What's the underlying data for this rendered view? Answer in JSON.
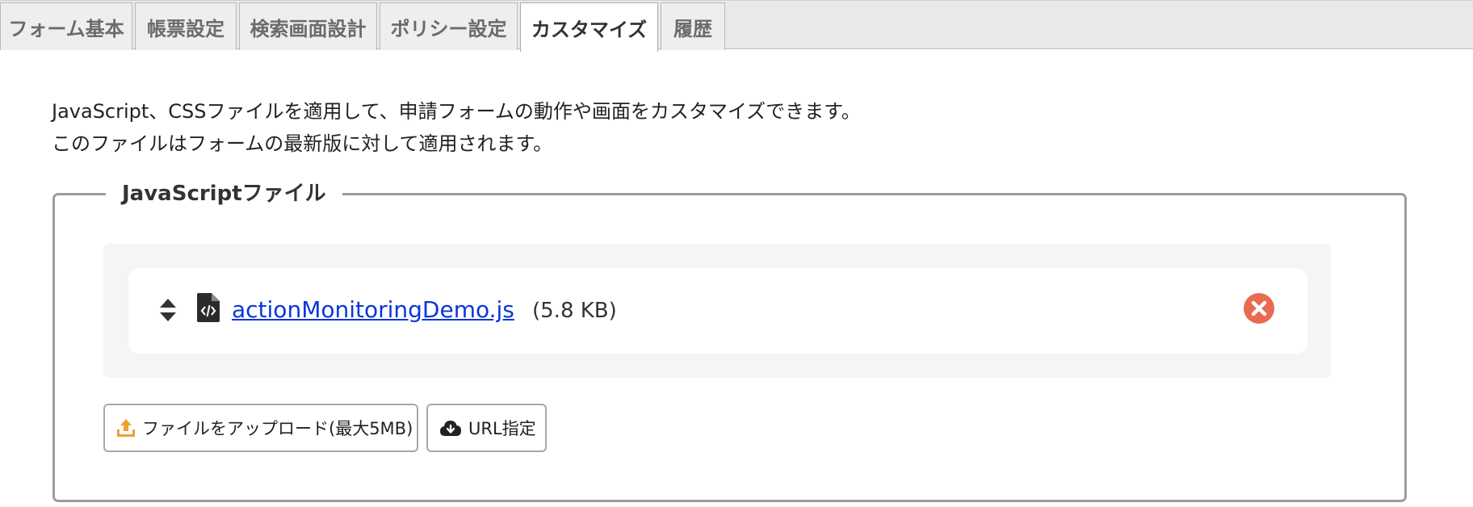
{
  "tabs": [
    {
      "label": "フォーム基本",
      "active": false
    },
    {
      "label": "帳票設定",
      "active": false
    },
    {
      "label": "検索画面設計",
      "active": false
    },
    {
      "label": "ポリシー設定",
      "active": false
    },
    {
      "label": "カスタマイズ",
      "active": true
    },
    {
      "label": "履歴",
      "active": false
    }
  ],
  "description": {
    "line1": "JavaScript、CSSファイルを適用して、申請フォームの動作や画面をカスタマイズできます。",
    "line2": "このファイルはフォームの最新版に対して適用されます。"
  },
  "javascript_section": {
    "legend": "JavaScriptファイル",
    "files": [
      {
        "name": "actionMonitoringDemo.js",
        "size": "(5.8 KB)"
      }
    ],
    "upload_button_label": "ファイルをアップロード(最大5MB)",
    "url_button_label": "URL指定"
  },
  "icons": {
    "sort": "sort-updown-icon",
    "file": "code-file-icon",
    "remove": "remove-circle-icon",
    "upload": "upload-icon",
    "cloud": "cloud-download-icon"
  },
  "colors": {
    "link": "#0b36d9",
    "remove": "#e86a52",
    "upload_icon": "#f0a030",
    "panel_border": "#9d9d9d"
  }
}
